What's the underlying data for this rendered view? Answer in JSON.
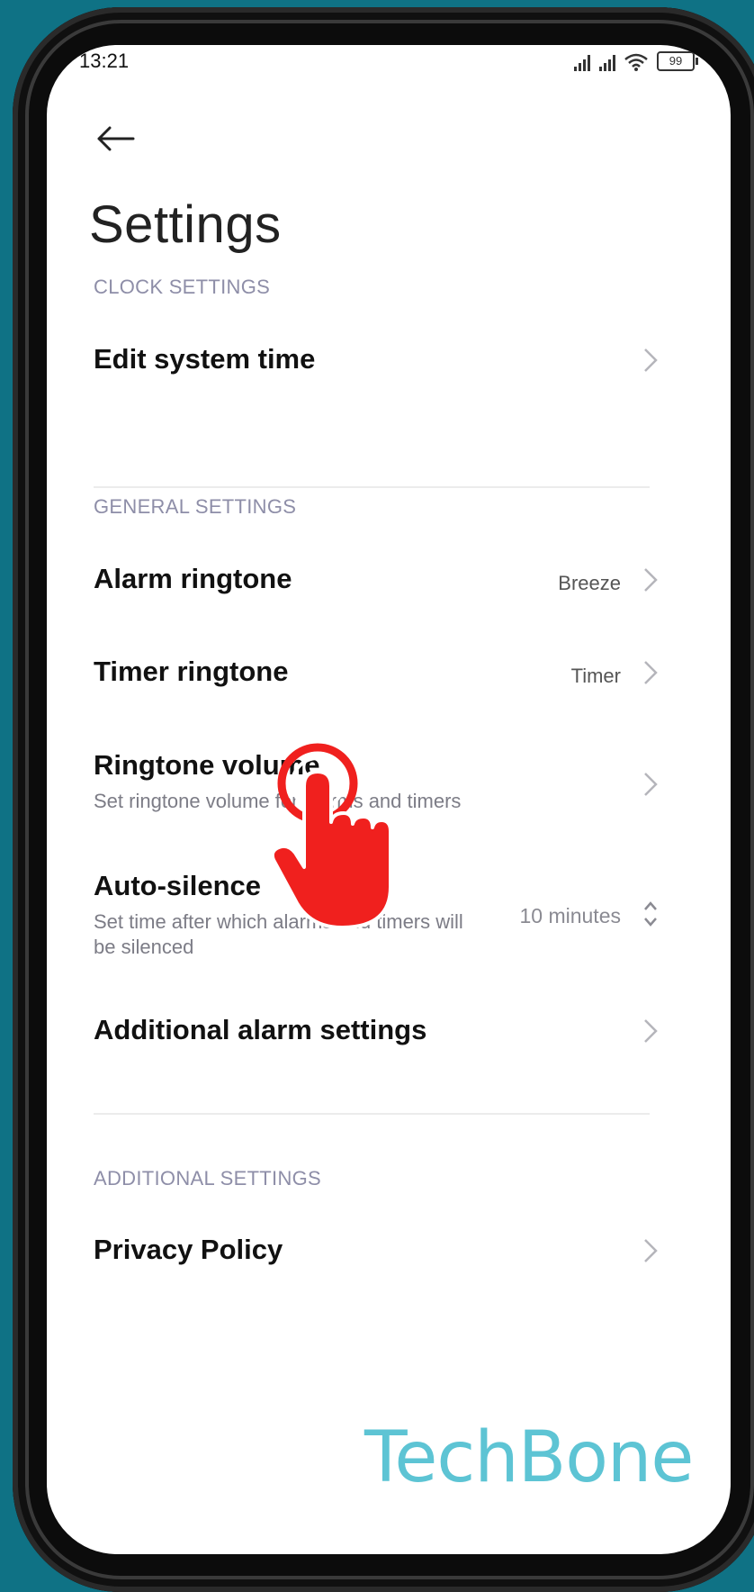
{
  "status_bar": {
    "time": "13:21",
    "battery": "99"
  },
  "header": {
    "title": "Settings"
  },
  "sections": {
    "clock": {
      "header": "CLOCK SETTINGS",
      "items": [
        {
          "title": "Edit system time"
        }
      ]
    },
    "general": {
      "header": "GENERAL SETTINGS",
      "items": [
        {
          "title": "Alarm ringtone",
          "value": "Breeze"
        },
        {
          "title": "Timer ringtone",
          "value": "Timer"
        },
        {
          "title": "Ringtone volume",
          "subtitle": "Set ringtone volume for alarms and timers"
        },
        {
          "title": "Auto-silence",
          "subtitle": "Set time after which alarms and timers will be silenced",
          "value": "10 minutes"
        },
        {
          "title": "Additional alarm settings"
        }
      ]
    },
    "additional": {
      "header": "ADDITIONAL SETTINGS",
      "items": [
        {
          "title": "Privacy Policy"
        }
      ]
    }
  },
  "watermark": "TechBone",
  "colors": {
    "background": "#0f7285",
    "accent_header": "#8e8ea8",
    "tap_indicator": "#f0201e",
    "watermark": "#5dc4d4"
  },
  "icons": [
    "back-arrow-icon",
    "chevron-right-icon",
    "up-down-chevron-icon",
    "signal-icon",
    "wifi-icon",
    "battery-icon",
    "tap-hand-icon"
  ]
}
